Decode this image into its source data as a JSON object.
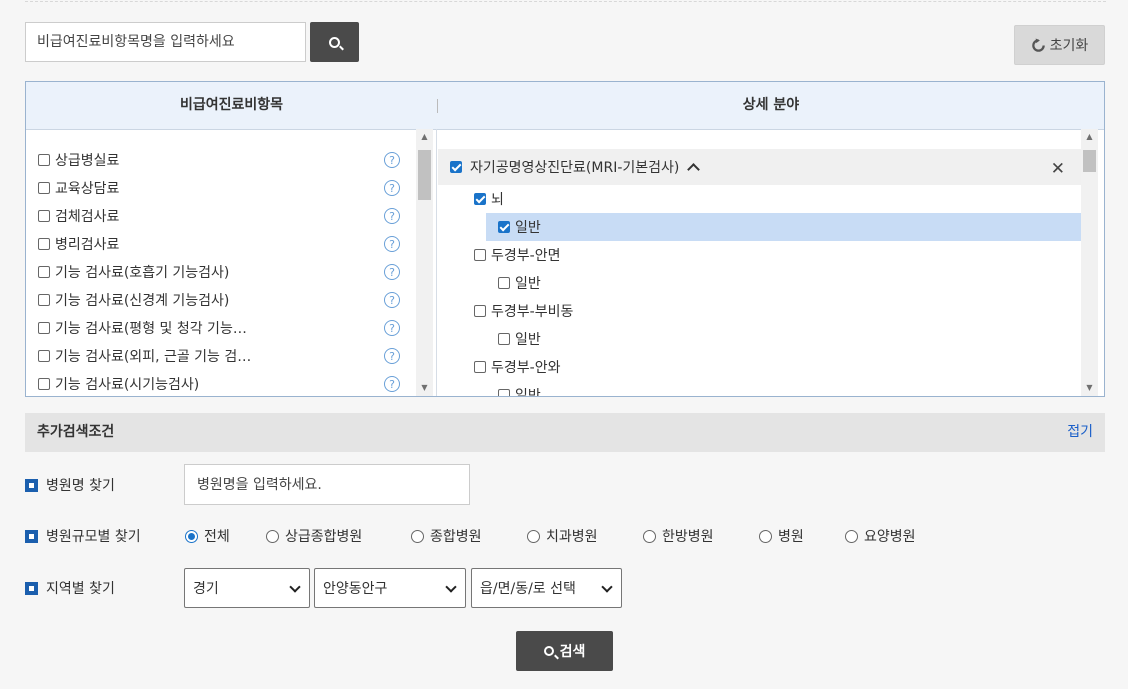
{
  "search": {
    "placeholder": "비급여진료비항목명을 입력하세요"
  },
  "reset_label": "초기화",
  "panel": {
    "left_header": "비급여진료비항목",
    "right_header": "상세 분야",
    "left_items": [
      "상급병실료",
      "교육상담료",
      "검체검사료",
      "병리검사료",
      "기능 검사료(호흡기 기능검사)",
      "기능 검사료(신경계 기능검사)",
      "기능 검사료(평형 및 청각 기능…",
      "기능 검사료(외피, 근골 기능 검…",
      "기능 검사료(시기능검사)"
    ],
    "help_glyph": "?",
    "right_group": "자기공명영상진단료(MRI-기본검사)",
    "right_close": "✕",
    "right_items": [
      {
        "label": "뇌",
        "level": 1,
        "checked": true
      },
      {
        "label": "일반",
        "level": 2,
        "checked": true,
        "selected": true
      },
      {
        "label": "두경부-안면",
        "level": 1,
        "checked": false
      },
      {
        "label": "일반",
        "level": 2,
        "checked": false
      },
      {
        "label": "두경부-부비동",
        "level": 1,
        "checked": false
      },
      {
        "label": "일반",
        "level": 2,
        "checked": false
      },
      {
        "label": "두경부-안와",
        "level": 1,
        "checked": false
      },
      {
        "label": "일반",
        "level": 2,
        "checked": false
      }
    ]
  },
  "additional": {
    "title": "추가검색조건",
    "fold": "접기",
    "hospital_name_label": "병원명 찾기",
    "hospital_name_placeholder": "병원명을 입력하세요.",
    "size_label": "병원규모별 찾기",
    "size_options": [
      "전체",
      "상급종합병원",
      "종합병원",
      "치과병원",
      "한방병원",
      "병원",
      "요양병원"
    ],
    "size_selected": "전체",
    "region_label": "지역별 찾기",
    "region_selects": [
      "경기",
      "안양동안구",
      "읍/면/동/로 선택"
    ]
  },
  "search_button": "검색",
  "colors": {
    "accent": "#1a73c9",
    "button_dark": "#4a4a4a",
    "header_bg": "#ebf2fb",
    "selected_row": "#c8dcf5"
  }
}
